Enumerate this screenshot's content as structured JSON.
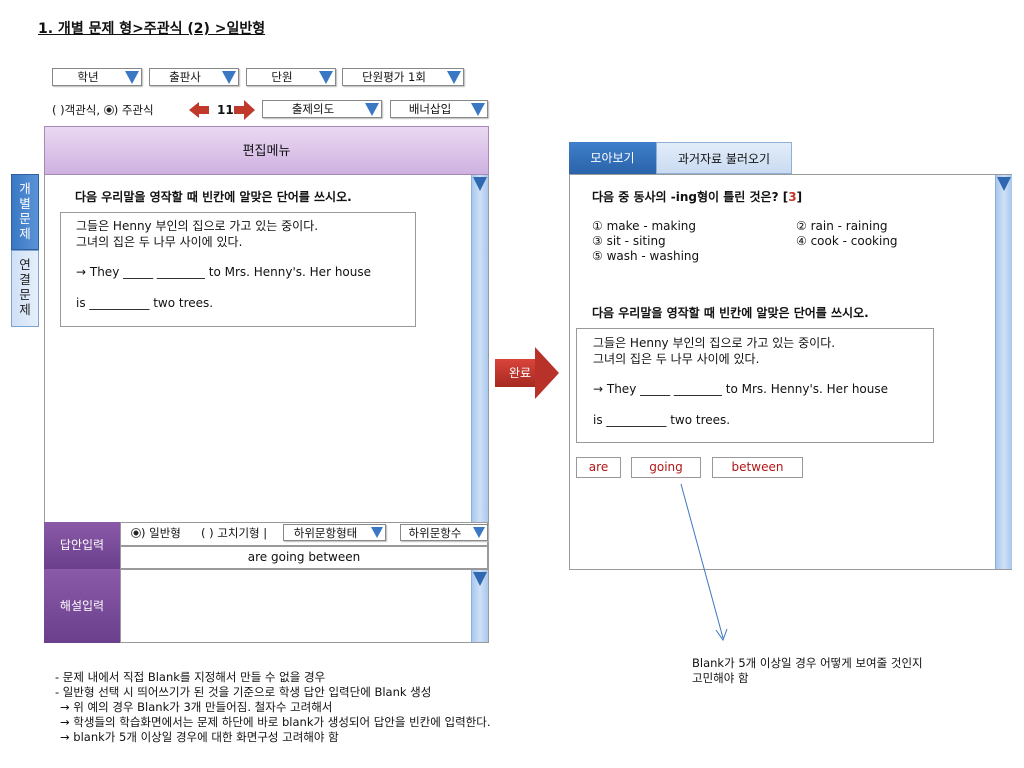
{
  "page_title": "1. 개별 문제 형>주관식 (2) >일반형",
  "selectors": {
    "grade": "학년",
    "publisher": "출판사",
    "unit": "단원",
    "unit_eval": "단원평가 1회",
    "intent": "출제의도",
    "banner": "배너삽입"
  },
  "type_row": {
    "objective": "( )객관식,",
    "subjective": ") 주관식",
    "question_number": "11"
  },
  "editor": {
    "menu_title": "편집메뉴",
    "side_tab_individual": "개별문제",
    "side_tab_linked": "연결문제",
    "question": "다음 우리말을 영작할 때 빈칸에 알맞은 단어를 쓰시오.",
    "korean_line1": "그들은 Henny 부인의 집으로 가고 있는 중이다.",
    "korean_line2": "그녀의 집은 두 나무 사이에 있다.",
    "english_line1": "→ They _____  ________  to Mrs. Henny's. Her house",
    "english_line2": "is __________   two trees."
  },
  "answer_section": {
    "answer_label": "답안입력",
    "explanation_label": "해설입력",
    "general_type": ") 일반형",
    "fix_type": "( ) 고치기형 |",
    "sub_form": "하위문항형태",
    "sub_count": "하위문항수",
    "answer_value": "are going between"
  },
  "complete_button": "완료",
  "preview": {
    "tab_collection": "모아보기",
    "tab_past": "과거자료 불러오기",
    "q1_text": "다음 중 동사의 -ing형이 틀린 것은?",
    "q1_answer_open": "[",
    "q1_answer": "3",
    "q1_answer_close": "]",
    "options": [
      "① make - making",
      "② rain - raining",
      "③ sit - siting",
      "④ cook - cooking",
      "⑤ wash - washing"
    ],
    "q2_text": "다음 우리말을 영작할 때 빈칸에 알맞은 단어를 쓰시오.",
    "korean_line1": "그들은 Henny 부인의 집으로 가고 있는 중이다.",
    "korean_line2": "그녀의 집은 두 나무 사이에 있다.",
    "english_line1": "→ They _____  ________  to Mrs. Henny's. Her house",
    "english_line2": "is __________   two trees.",
    "chips": [
      "are",
      "going",
      "between"
    ]
  },
  "annotation": {
    "line1": "Blank가 5개 이상일 경우 어떻게 보여줄 것인지",
    "line2": "고민해야 함"
  },
  "notes": [
    "- 문제 내에서 직접 Blank를 지정해서 만들 수 없을 경우",
    "- 일반형 선택 시 띄어쓰기가 된 것을 기준으로 학생 답안 입력단에 Blank 생성",
    "→ 위 예의 경우 Blank가 3개 만들어짐. 철자수 고려해서",
    "→ 학생들의 학습화면에서는 문제 하단에 바로 blank가 생성되어 답안을 빈칸에 입력한다.",
    "→ blank가 5개 이상일 경우에 대한 화면구성 고려해야 함"
  ],
  "colors": {
    "accent_blue": "#3a78c4",
    "purple": "#7a4a9a",
    "arrow_red": "#c0392b",
    "answer_red": "#b31616"
  }
}
